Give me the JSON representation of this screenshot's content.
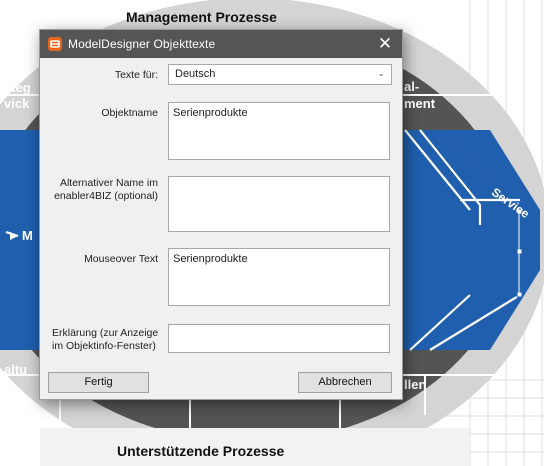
{
  "background": {
    "top_title": "Management Prozesse",
    "bottom_title": "Unterstützende Prozesse",
    "left_label_1": "ateg",
    "left_label_2": "vick",
    "right_label_1": "al-",
    "right_label_2": "ment",
    "service_label": "Service",
    "mid_left_label": "M",
    "bottom_left_label": "altu",
    "bottom_right_label": "llen",
    "colors": {
      "dark_ring": "#545454",
      "blue": "#1f5fae",
      "light_ring": "#d4d4d4"
    }
  },
  "dialog": {
    "title": "ModelDesigner Objekttexte",
    "close_icon": "close-icon",
    "language": {
      "label": "Texte für:",
      "value": "Deutsch"
    },
    "objektname": {
      "label": "Objektname",
      "value": "Serienprodukte"
    },
    "alt_name": {
      "label_line1": "Alternativer Name im",
      "label_line2": "enabler4BIZ (optional)",
      "value": ""
    },
    "mouseover": {
      "label": "Mouseover Text",
      "value": "Serienprodukte"
    },
    "erklaerung": {
      "label_line1": "Erklärung (zur Anzeige",
      "label_line2": "im Objektinfo-Fenster)",
      "value": ""
    },
    "ok_button": "Fertig",
    "cancel_button": "Abbrechen",
    "colors": {
      "titlebar": "#555555",
      "icon": "#e8661e"
    }
  }
}
